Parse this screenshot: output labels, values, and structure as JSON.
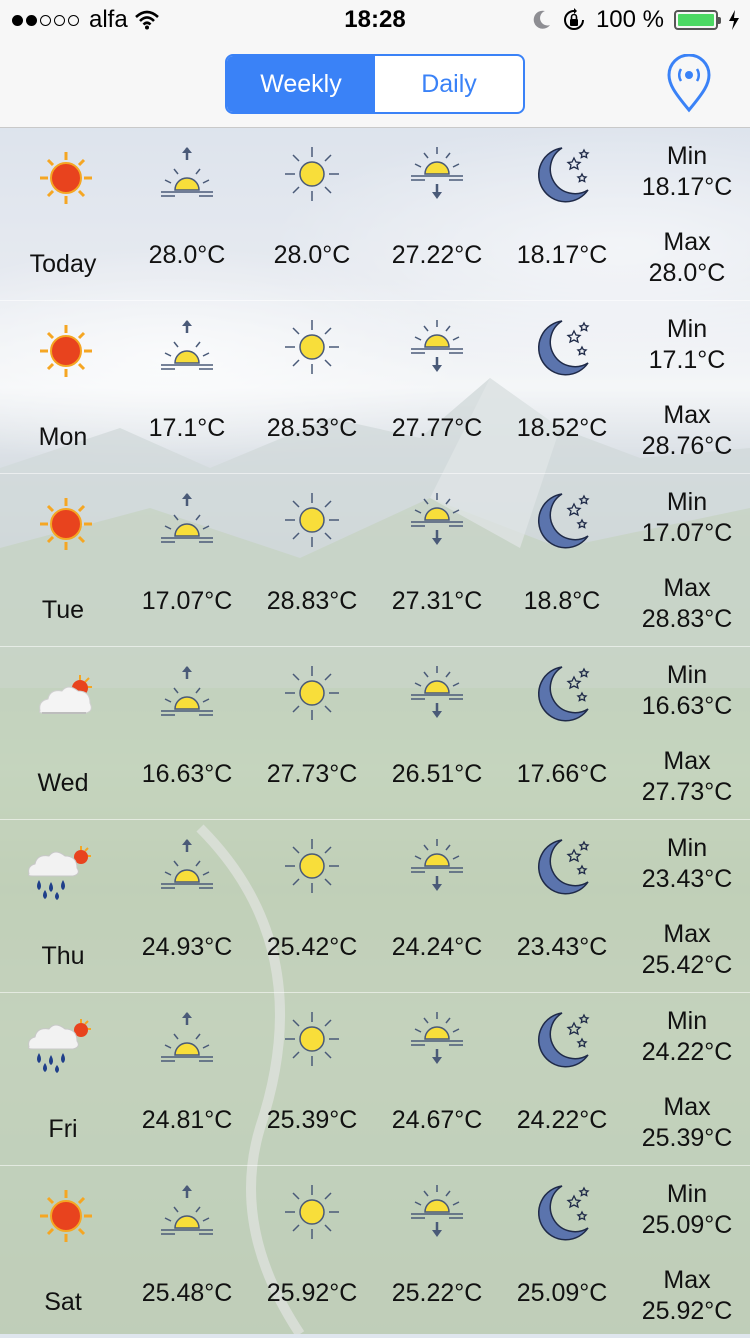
{
  "status_bar": {
    "carrier": "alfa",
    "time": "18:28",
    "battery_percent": "100 %",
    "signal_bars_filled": 2,
    "signal_bars_total": 5
  },
  "nav": {
    "segments": [
      {
        "label": "Weekly",
        "selected": true
      },
      {
        "label": "Daily",
        "selected": false
      }
    ],
    "accent_color": "#3a82f7"
  },
  "icons": {
    "sunrise": "sunrise-icon",
    "noon": "sun-icon",
    "sunset": "sunset-icon",
    "night": "moon-stars-icon"
  },
  "min_label": "Min",
  "max_label": "Max",
  "days": [
    {
      "day": "Today",
      "condition": "sunny",
      "sunrise": "28.0°C",
      "noon": "28.0°C",
      "sunset": "27.22°C",
      "night": "18.17°C",
      "min": "18.17°C",
      "max": "28.0°C"
    },
    {
      "day": "Mon",
      "condition": "sunny",
      "sunrise": "17.1°C",
      "noon": "28.53°C",
      "sunset": "27.77°C",
      "night": "18.52°C",
      "min": "17.1°C",
      "max": "28.76°C"
    },
    {
      "day": "Tue",
      "condition": "sunny",
      "sunrise": "17.07°C",
      "noon": "28.83°C",
      "sunset": "27.31°C",
      "night": "18.8°C",
      "min": "17.07°C",
      "max": "28.83°C"
    },
    {
      "day": "Wed",
      "condition": "partly-cloudy",
      "sunrise": "16.63°C",
      "noon": "27.73°C",
      "sunset": "26.51°C",
      "night": "17.66°C",
      "min": "16.63°C",
      "max": "27.73°C"
    },
    {
      "day": "Thu",
      "condition": "rain",
      "sunrise": "24.93°C",
      "noon": "25.42°C",
      "sunset": "24.24°C",
      "night": "23.43°C",
      "min": "23.43°C",
      "max": "25.42°C"
    },
    {
      "day": "Fri",
      "condition": "rain",
      "sunrise": "24.81°C",
      "noon": "25.39°C",
      "sunset": "24.67°C",
      "night": "24.22°C",
      "min": "24.22°C",
      "max": "25.39°C"
    },
    {
      "day": "Sat",
      "condition": "sunny",
      "sunrise": "25.48°C",
      "noon": "25.92°C",
      "sunset": "25.22°C",
      "night": "25.09°C",
      "min": "25.09°C",
      "max": "25.92°C"
    }
  ]
}
